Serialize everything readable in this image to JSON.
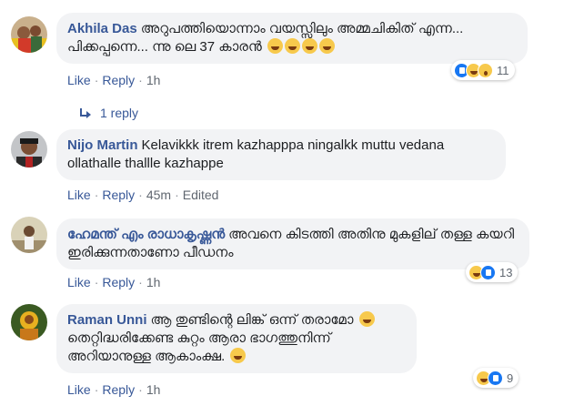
{
  "comments": [
    {
      "author": "Akhila Das",
      "text": "അറുപത്തിയൊന്നാം വയസ്സിലും അമ്മചികിത് എന്ന... പിക്കപ്പന്നെ... ന്നു ലെ 37 കാരൻ",
      "emoji_count": 4,
      "reaction_count": "11",
      "reactions": [
        "like-icon",
        "haha-icon",
        "wow-icon"
      ],
      "actions": {
        "like": "Like",
        "reply": "Reply",
        "time": "1h"
      },
      "replies_label": "1 reply"
    },
    {
      "author": "Nijo Martin",
      "text": "Kelavikkk itrem kazhapppa ningalkk muttu vedana ollathalle thallle kazhappe",
      "actions": {
        "like": "Like",
        "reply": "Reply",
        "time": "45m",
        "edited": "Edited"
      }
    },
    {
      "author": "ഹേമന്ത് എം രാധാകൃഷ്ണൻ",
      "text": "അവനെ കിടത്തി അതിനു മുകളില് തള്ള കയറി ഇരിക്കുന്നതാണോ പീഡനം",
      "reaction_count": "13",
      "reactions": [
        "haha-icon",
        "like-icon"
      ],
      "actions": {
        "like": "Like",
        "reply": "Reply",
        "time": "1h"
      }
    },
    {
      "author": "Raman Unni",
      "text_line1": "ആ തുണ്ടിന്റെ ലിങ്ക് ഒന്ന് തരാമോ",
      "text_line2": "തെറ്റിദ്ധരിക്കേണ്ട കുറ്റം ആരാ ഭാഗത്തുനിന്ന്",
      "text_line3": "അറിയാനുള്ള ആകാംക്ഷ.",
      "reaction_count": "9",
      "reactions": [
        "haha-icon",
        "like-icon"
      ],
      "actions": {
        "like": "Like",
        "reply": "Reply",
        "time": "1h"
      }
    }
  ]
}
